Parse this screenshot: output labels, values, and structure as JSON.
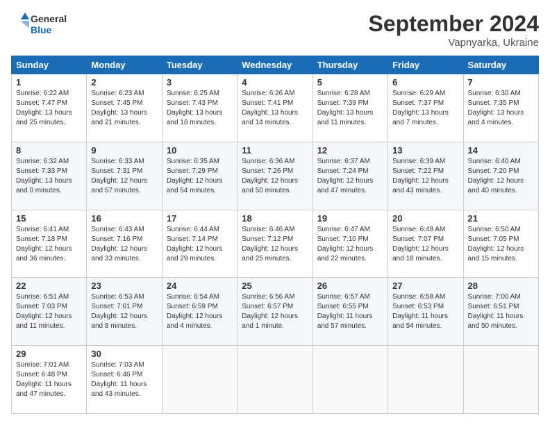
{
  "header": {
    "logo_line1": "General",
    "logo_line2": "Blue",
    "month": "September 2024",
    "location": "Vapnyarka, Ukraine"
  },
  "days_of_week": [
    "Sunday",
    "Monday",
    "Tuesday",
    "Wednesday",
    "Thursday",
    "Friday",
    "Saturday"
  ],
  "weeks": [
    [
      {
        "day": "1",
        "lines": [
          "Sunrise: 6:22 AM",
          "Sunset: 7:47 PM",
          "Daylight: 13 hours",
          "and 25 minutes."
        ]
      },
      {
        "day": "2",
        "lines": [
          "Sunrise: 6:23 AM",
          "Sunset: 7:45 PM",
          "Daylight: 13 hours",
          "and 21 minutes."
        ]
      },
      {
        "day": "3",
        "lines": [
          "Sunrise: 6:25 AM",
          "Sunset: 7:43 PM",
          "Daylight: 13 hours",
          "and 18 minutes."
        ]
      },
      {
        "day": "4",
        "lines": [
          "Sunrise: 6:26 AM",
          "Sunset: 7:41 PM",
          "Daylight: 13 hours",
          "and 14 minutes."
        ]
      },
      {
        "day": "5",
        "lines": [
          "Sunrise: 6:28 AM",
          "Sunset: 7:39 PM",
          "Daylight: 13 hours",
          "and 11 minutes."
        ]
      },
      {
        "day": "6",
        "lines": [
          "Sunrise: 6:29 AM",
          "Sunset: 7:37 PM",
          "Daylight: 13 hours",
          "and 7 minutes."
        ]
      },
      {
        "day": "7",
        "lines": [
          "Sunrise: 6:30 AM",
          "Sunset: 7:35 PM",
          "Daylight: 13 hours",
          "and 4 minutes."
        ]
      }
    ],
    [
      {
        "day": "8",
        "lines": [
          "Sunrise: 6:32 AM",
          "Sunset: 7:33 PM",
          "Daylight: 13 hours",
          "and 0 minutes."
        ]
      },
      {
        "day": "9",
        "lines": [
          "Sunrise: 6:33 AM",
          "Sunset: 7:31 PM",
          "Daylight: 12 hours",
          "and 57 minutes."
        ]
      },
      {
        "day": "10",
        "lines": [
          "Sunrise: 6:35 AM",
          "Sunset: 7:29 PM",
          "Daylight: 12 hours",
          "and 54 minutes."
        ]
      },
      {
        "day": "11",
        "lines": [
          "Sunrise: 6:36 AM",
          "Sunset: 7:26 PM",
          "Daylight: 12 hours",
          "and 50 minutes."
        ]
      },
      {
        "day": "12",
        "lines": [
          "Sunrise: 6:37 AM",
          "Sunset: 7:24 PM",
          "Daylight: 12 hours",
          "and 47 minutes."
        ]
      },
      {
        "day": "13",
        "lines": [
          "Sunrise: 6:39 AM",
          "Sunset: 7:22 PM",
          "Daylight: 12 hours",
          "and 43 minutes."
        ]
      },
      {
        "day": "14",
        "lines": [
          "Sunrise: 6:40 AM",
          "Sunset: 7:20 PM",
          "Daylight: 12 hours",
          "and 40 minutes."
        ]
      }
    ],
    [
      {
        "day": "15",
        "lines": [
          "Sunrise: 6:41 AM",
          "Sunset: 7:18 PM",
          "Daylight: 12 hours",
          "and 36 minutes."
        ]
      },
      {
        "day": "16",
        "lines": [
          "Sunrise: 6:43 AM",
          "Sunset: 7:16 PM",
          "Daylight: 12 hours",
          "and 33 minutes."
        ]
      },
      {
        "day": "17",
        "lines": [
          "Sunrise: 6:44 AM",
          "Sunset: 7:14 PM",
          "Daylight: 12 hours",
          "and 29 minutes."
        ]
      },
      {
        "day": "18",
        "lines": [
          "Sunrise: 6:46 AM",
          "Sunset: 7:12 PM",
          "Daylight: 12 hours",
          "and 25 minutes."
        ]
      },
      {
        "day": "19",
        "lines": [
          "Sunrise: 6:47 AM",
          "Sunset: 7:10 PM",
          "Daylight: 12 hours",
          "and 22 minutes."
        ]
      },
      {
        "day": "20",
        "lines": [
          "Sunrise: 6:48 AM",
          "Sunset: 7:07 PM",
          "Daylight: 12 hours",
          "and 18 minutes."
        ]
      },
      {
        "day": "21",
        "lines": [
          "Sunrise: 6:50 AM",
          "Sunset: 7:05 PM",
          "Daylight: 12 hours",
          "and 15 minutes."
        ]
      }
    ],
    [
      {
        "day": "22",
        "lines": [
          "Sunrise: 6:51 AM",
          "Sunset: 7:03 PM",
          "Daylight: 12 hours",
          "and 11 minutes."
        ]
      },
      {
        "day": "23",
        "lines": [
          "Sunrise: 6:53 AM",
          "Sunset: 7:01 PM",
          "Daylight: 12 hours",
          "and 8 minutes."
        ]
      },
      {
        "day": "24",
        "lines": [
          "Sunrise: 6:54 AM",
          "Sunset: 6:59 PM",
          "Daylight: 12 hours",
          "and 4 minutes."
        ]
      },
      {
        "day": "25",
        "lines": [
          "Sunrise: 6:56 AM",
          "Sunset: 6:57 PM",
          "Daylight: 12 hours",
          "and 1 minute."
        ]
      },
      {
        "day": "26",
        "lines": [
          "Sunrise: 6:57 AM",
          "Sunset: 6:55 PM",
          "Daylight: 11 hours",
          "and 57 minutes."
        ]
      },
      {
        "day": "27",
        "lines": [
          "Sunrise: 6:58 AM",
          "Sunset: 6:53 PM",
          "Daylight: 11 hours",
          "and 54 minutes."
        ]
      },
      {
        "day": "28",
        "lines": [
          "Sunrise: 7:00 AM",
          "Sunset: 6:51 PM",
          "Daylight: 11 hours",
          "and 50 minutes."
        ]
      }
    ],
    [
      {
        "day": "29",
        "lines": [
          "Sunrise: 7:01 AM",
          "Sunset: 6:48 PM",
          "Daylight: 11 hours",
          "and 47 minutes."
        ]
      },
      {
        "day": "30",
        "lines": [
          "Sunrise: 7:03 AM",
          "Sunset: 6:46 PM",
          "Daylight: 11 hours",
          "and 43 minutes."
        ]
      },
      {
        "day": "",
        "lines": []
      },
      {
        "day": "",
        "lines": []
      },
      {
        "day": "",
        "lines": []
      },
      {
        "day": "",
        "lines": []
      },
      {
        "day": "",
        "lines": []
      }
    ]
  ]
}
